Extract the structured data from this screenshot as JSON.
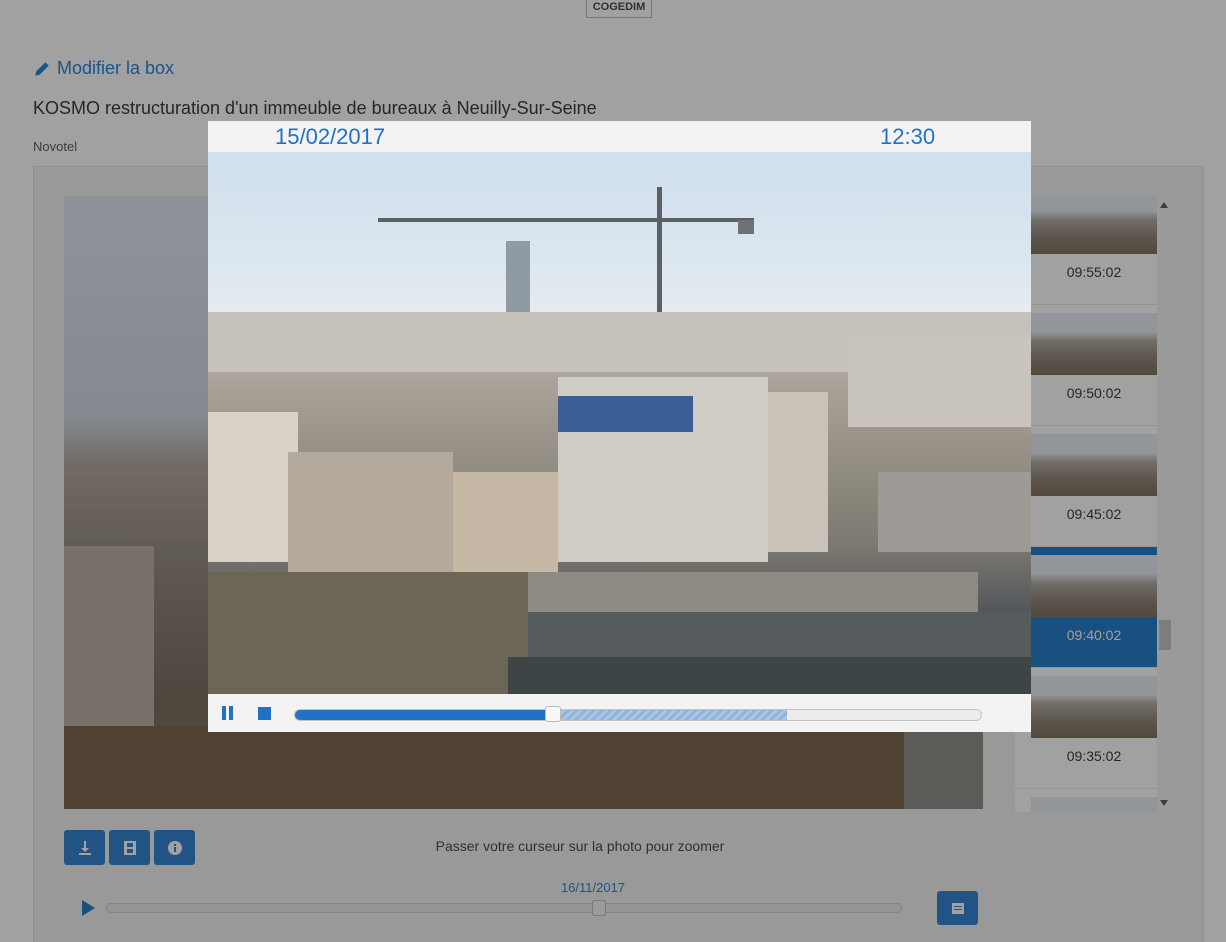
{
  "header": {
    "brand": "COGEDIM"
  },
  "box": {
    "edit_label": "Modifier la box",
    "title": "KOSMO restructuration d'un immeuble de bureaux à Neuilly-Sur-Seine",
    "subtitle": "Novotel"
  },
  "thumbnails": [
    {
      "time": "09:55:02",
      "active": false
    },
    {
      "time": "09:50:02",
      "active": false
    },
    {
      "time": "09:45:02",
      "active": false
    },
    {
      "time": "09:40:02",
      "active": true
    },
    {
      "time": "09:35:02",
      "active": false
    },
    {
      "time": "",
      "active": false
    }
  ],
  "toolbar": {
    "buttons": [
      {
        "icon": "download-icon"
      },
      {
        "icon": "film-icon"
      },
      {
        "icon": "info-icon"
      }
    ],
    "zoom_hint": "Passer votre curseur sur la photo pour zoomer"
  },
  "timeline": {
    "date": "16/11/2017",
    "position": 0.62,
    "play_icon": "play-icon",
    "calendar_icon": "calendar-icon"
  },
  "player": {
    "date": "15/02/2017",
    "time": "12:30",
    "progress": 0.377,
    "buffered": 0.717,
    "pause_icon": "pause-icon",
    "stop_icon": "stop-icon"
  },
  "colors": {
    "accent": "#1f72c4",
    "button": "#2b7fd0",
    "overlay": "rgba(20,20,20,0.40)"
  }
}
